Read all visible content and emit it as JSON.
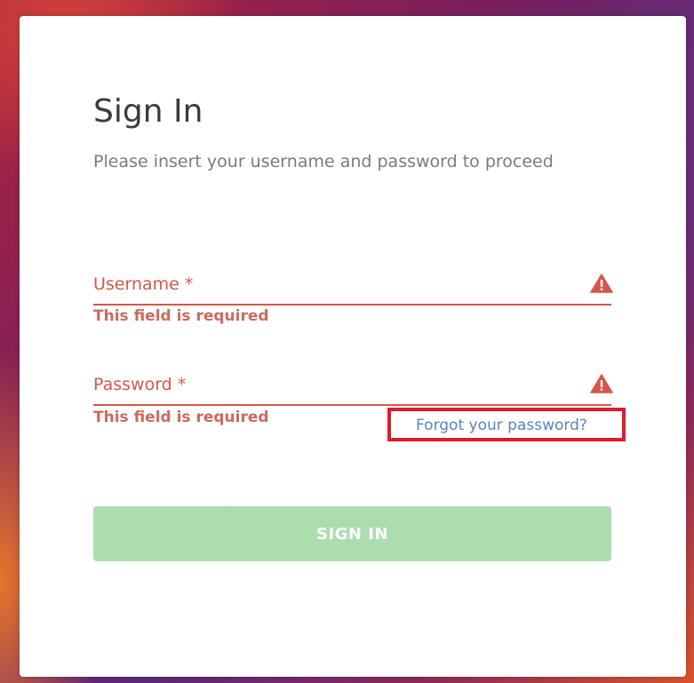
{
  "form": {
    "title": "Sign In",
    "subtitle": "Please insert your username and password to proceed",
    "username": {
      "label": "Username *",
      "value": "",
      "error": "This field is required",
      "icon": "warning-triangle-icon"
    },
    "password": {
      "label": "Password *",
      "value": "",
      "error": "This field is required",
      "icon": "warning-triangle-icon"
    },
    "forgot_password_link": "Forgot your password?",
    "submit_label": "SIGN IN",
    "submit_disabled": true
  },
  "colors": {
    "error": "#d4584a",
    "link": "#5a86b6",
    "button_disabled": "#a8dcab",
    "highlight_box": "#e01b2b"
  }
}
